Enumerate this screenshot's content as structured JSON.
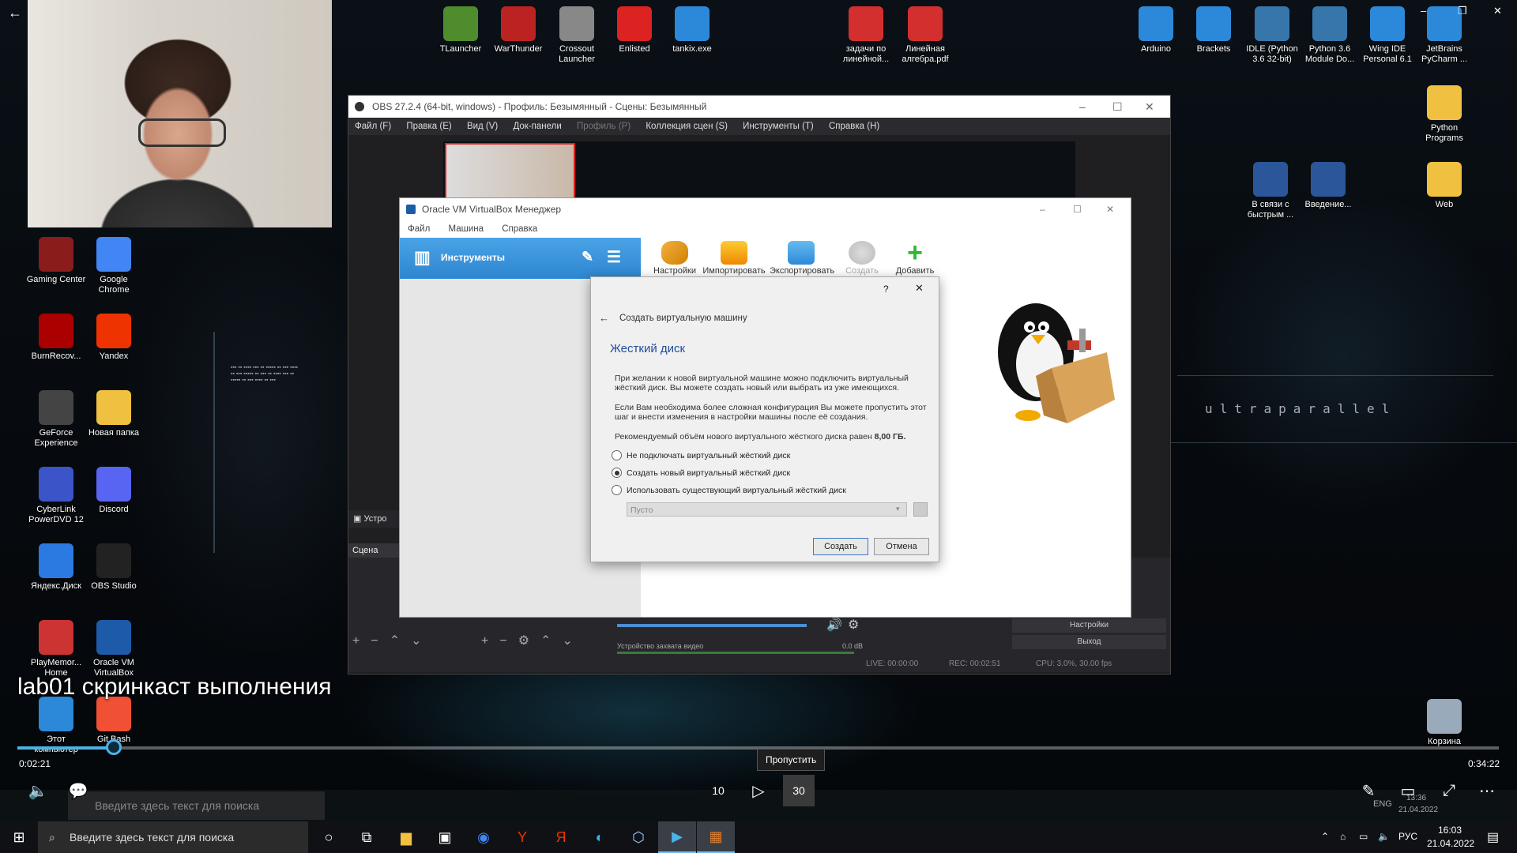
{
  "video": {
    "caption": "lab01 скринкаст выполнения",
    "elapsed": "0:02:21",
    "remaining": "0:34:22",
    "progress_fraction": 0.065,
    "skip_tooltip": "Пропустить",
    "rewind_label": "10",
    "forward_label": "30"
  },
  "desktop_icons_left": [
    {
      "label": "Gaming Center",
      "icon": "gaming-center-icon",
      "color": "#8a1c1c"
    },
    {
      "label": "Google Chrome",
      "icon": "chrome-icon",
      "color": "#4285f4"
    },
    {
      "label": "BurnRecov...",
      "icon": "burnrecovery-icon",
      "color": "#a00"
    },
    {
      "label": "Yandex",
      "icon": "yandex-icon",
      "color": "#e30"
    },
    {
      "label": "GeForce Experience",
      "icon": "geforce-icon",
      "color": "#444"
    },
    {
      "label": "Новая папка",
      "icon": "folder-icon",
      "color": "#f0c040"
    },
    {
      "label": "CyberLink PowerDVD 12",
      "icon": "powerdvd-icon",
      "color": "#3b55c8"
    },
    {
      "label": "Discord",
      "icon": "discord-icon",
      "color": "#5865f2"
    },
    {
      "label": "Яндекс.Диск",
      "icon": "yandex-disk-icon",
      "color": "#2a7ae2"
    },
    {
      "label": "OBS Studio",
      "icon": "obs-icon",
      "color": "#222"
    },
    {
      "label": "PlayMemor... Home",
      "icon": "playmemories-icon",
      "color": "#c33"
    },
    {
      "label": "Oracle VM VirtualBox",
      "icon": "virtualbox-icon",
      "color": "#1d5aa8"
    },
    {
      "label": "Этот компьютер",
      "icon": "computer-icon",
      "color": "#2c89d9"
    },
    {
      "label": "Git Bash",
      "icon": "git-bash-icon",
      "color": "#f05033"
    }
  ],
  "desktop_icons_top": [
    {
      "label": "TLauncher",
      "icon": "tlauncher-icon",
      "color": "#4f8c2d"
    },
    {
      "label": "WarThunder",
      "icon": "warthunder-icon",
      "color": "#b22"
    },
    {
      "label": "Crossout Launcher",
      "icon": "crossout-icon",
      "color": "#888"
    },
    {
      "label": "Enlisted",
      "icon": "enlisted-icon",
      "color": "#d22"
    },
    {
      "label": "tankix.exe",
      "icon": "tankix-icon",
      "color": "#2c89d9"
    },
    {
      "label": "задачи по линейной...",
      "icon": "pdf-icon",
      "color": "#d32f2f"
    },
    {
      "label": "Линейная алгебра.pdf",
      "icon": "pdf-icon",
      "color": "#d32f2f"
    },
    {
      "label": "Arduino",
      "icon": "arduino-icon",
      "color": "#2c89d9"
    },
    {
      "label": "Brackets",
      "icon": "brackets-icon",
      "color": "#2c89d9"
    },
    {
      "label": "IDLE (Python 3.6 32-bit)",
      "icon": "python-icon",
      "color": "#3776ab"
    },
    {
      "label": "Python 3.6 Module Do...",
      "icon": "python-icon",
      "color": "#3776ab"
    },
    {
      "label": "Wing IDE Personal 6.1",
      "icon": "wing-icon",
      "color": "#2c89d9"
    },
    {
      "label": "JetBrains PyCharm ...",
      "icon": "pycharm-icon",
      "color": "#2c89d9"
    }
  ],
  "desktop_icons_right": [
    {
      "label": "Python Programs",
      "icon": "folder-icon",
      "color": "#f0c040"
    },
    {
      "label": "В связи с быстрым ...",
      "icon": "word-icon",
      "color": "#2b579a"
    },
    {
      "label": "Введение...",
      "icon": "word-icon",
      "color": "#2b579a"
    },
    {
      "label": "Web",
      "icon": "folder-icon",
      "color": "#f0c040"
    },
    {
      "label": "Корзина",
      "icon": "recycle-bin-icon",
      "color": "#9ab"
    }
  ],
  "wallpaper_text": "ultraparallel",
  "obs": {
    "title": "OBS 27.2.4 (64-bit, windows) - Профиль: Безымянный - Сцены: Безымянный",
    "menu": [
      "Файл (F)",
      "Правка (E)",
      "Вид (V)",
      "Док-панели",
      "Профиль (P)",
      "Коллекция сцен (S)",
      "Инструменты (T)",
      "Справка (H)"
    ],
    "scene_label": "Сцена",
    "source_dock": "Устро",
    "mixer_source": "Устройство захвата видео",
    "mixer_db": "0.0 dB",
    "controls": [
      "Настройки",
      "Выход"
    ],
    "status": {
      "live": "LIVE: 00:00:00",
      "rec": "REC: 00:02:51",
      "cpu": "CPU: 3.0%, 30.00 fps"
    }
  },
  "vbox": {
    "title": "Oracle VM VirtualBox Менеджер",
    "menu": [
      "Файл",
      "Машина",
      "Справка"
    ],
    "tools_label": "Инструменты",
    "toolbar": [
      "Настройки",
      "Импортировать",
      "Экспортировать",
      "Создать",
      "Добавить"
    ]
  },
  "dialog": {
    "back_header": "Создать виртуальную машину",
    "heading": "Жесткий диск",
    "para1": "При желании к новой виртуальной машине можно подключить виртуальный жёсткий диск. Вы можете создать новый или выбрать из уже имеющихся.",
    "para2": "Если Вам необходима более сложная конфигурация Вы можете пропустить этот шаг и внести изменения в настройки машины после её создания.",
    "para3": "Рекомендуемый объём нового виртуального жёсткого диска равен",
    "recommended_size": "8,00 ГБ.",
    "options": [
      {
        "label": "Не подключать виртуальный жёсткий диск",
        "selected": false
      },
      {
        "label": "Создать новый виртуальный жёсткий диск",
        "selected": true
      },
      {
        "label": "Использовать существующий виртуальный жёсткий диск",
        "selected": false
      }
    ],
    "select_value": "Пусто",
    "create_button": "Создать",
    "cancel_button": "Отмена",
    "help": "?",
    "close": "✕"
  },
  "inner_taskbar": {
    "search_placeholder": "Введите здесь текст для поиска",
    "lang": "ENG",
    "time": "13:36",
    "date": "21.04.2022"
  },
  "taskbar": {
    "search_placeholder": "Введите здесь текст для поиска",
    "lang": "РУС",
    "time": "16:03",
    "date": "21.04.2022"
  }
}
